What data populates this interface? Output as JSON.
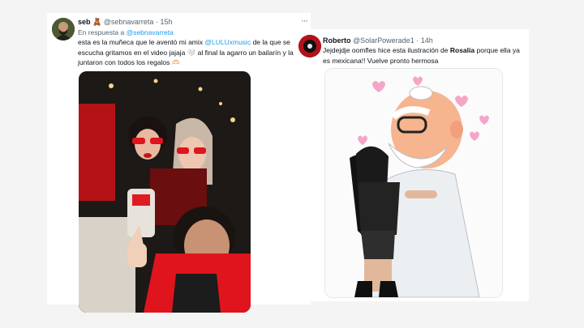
{
  "tweet1": {
    "display_name": "seb",
    "name_emoji": "🧸",
    "handle": "@sebnavarreta",
    "separator": "·",
    "time": "15h",
    "more": "···",
    "reply_prefix": "En respuesta a",
    "reply_handle": "@sebnavarreta",
    "text_1": "esta es la muñeca que le aventó mi amix ",
    "mention": "@LULUxmusic",
    "text_2": " de la que se escucha gritamos en el video jajaja 🤍 al final la agarro un bailarín y la juntaron con todos los regalos 🫶🏻"
  },
  "tweet2": {
    "display_name": "Roberto",
    "handle": "@SolarPowerade1",
    "separator": "·",
    "time": "14h",
    "text_1": "Jejdejdje oomfles hice esta ilustración de ",
    "text_bold": "Rosalía",
    "text_2": " porque ella ya es mexicana!! Vuelve pronto hermosa"
  },
  "colors": {
    "link": "#1d9bf0",
    "muted": "#536471",
    "text": "#0f1419",
    "card": "#ffffff",
    "background": "#f4f4f4"
  },
  "icons": {
    "more": "more-horizontal-icon",
    "name_emoji": "teddy-bear-emoji"
  }
}
